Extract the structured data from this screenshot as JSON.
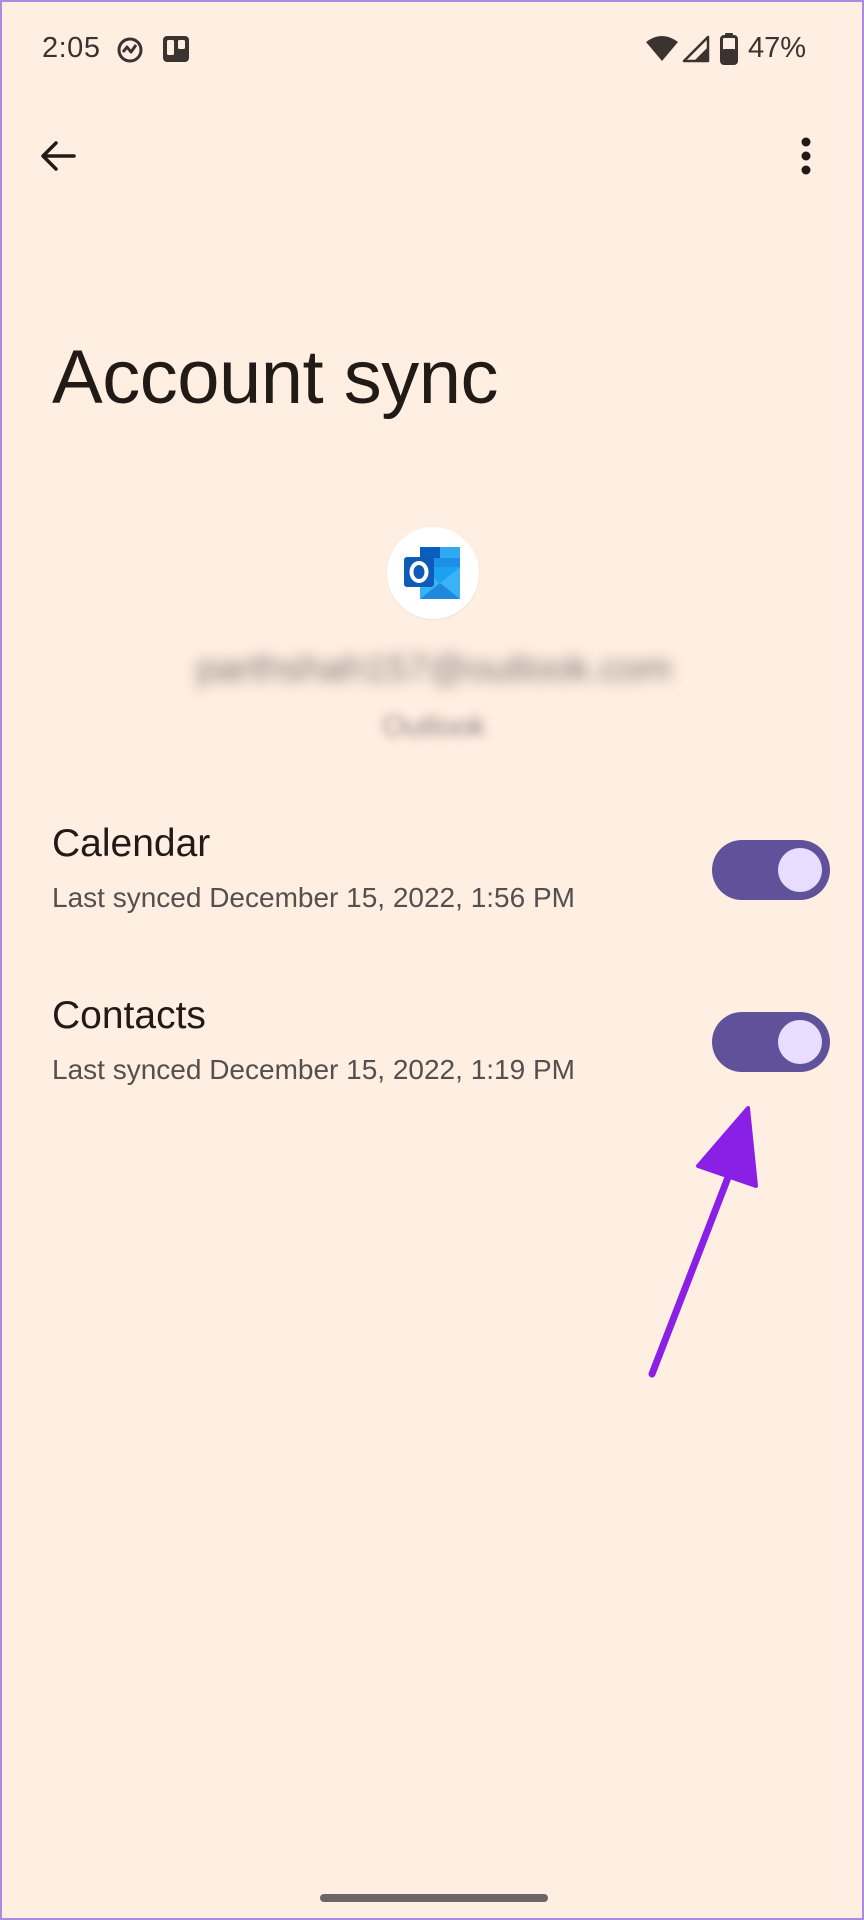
{
  "status_bar": {
    "time": "2:05",
    "battery": "47%",
    "icons": [
      "activity-icon",
      "trello-icon",
      "wifi-icon",
      "signal-icon",
      "battery-icon"
    ]
  },
  "app_bar": {
    "back_icon": "arrow-back-icon",
    "more_icon": "more-vert-icon"
  },
  "page": {
    "title": "Account sync"
  },
  "account": {
    "email": "parthshah157@outlook.com",
    "type": "Outlook",
    "icon": "outlook-logo"
  },
  "sync_items": [
    {
      "label": "Calendar",
      "last_synced": "Last synced December 15, 2022, 1:56 PM",
      "enabled": true
    },
    {
      "label": "Contacts",
      "last_synced": "Last synced December 15, 2022, 1:19 PM",
      "enabled": true
    }
  ],
  "colors": {
    "background": "#FFEEE2",
    "toggle_track": "#5F529A",
    "toggle_knob": "#E9DDFF",
    "annotation_arrow": "#8A1FE6"
  }
}
